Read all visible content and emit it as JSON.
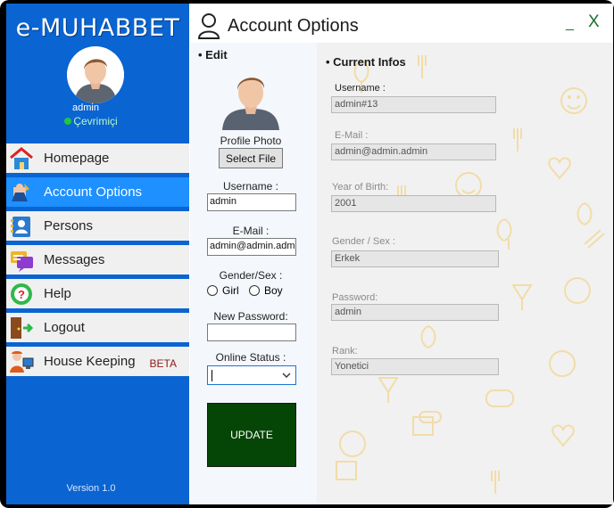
{
  "app": {
    "logo": "e-MUHABBET",
    "user_name": "admin",
    "status": "Çevrimiçi",
    "version": "Version 1.0"
  },
  "nav": [
    {
      "label": "Homepage",
      "icon": "home-icon",
      "active": false
    },
    {
      "label": "Account Options",
      "icon": "account-options-icon",
      "active": true
    },
    {
      "label": "Persons",
      "icon": "persons-icon",
      "active": false
    },
    {
      "label": "Messages",
      "icon": "messages-icon",
      "active": false
    },
    {
      "label": "Help",
      "icon": "help-icon",
      "active": false
    },
    {
      "label": "Logout",
      "icon": "logout-icon",
      "active": false
    },
    {
      "label": "House Keeping",
      "icon": "house-keeping-icon",
      "active": false,
      "badge": "BETA"
    }
  ],
  "header": {
    "title": "Account Options",
    "minimize": "_",
    "close": "X"
  },
  "edit": {
    "heading": "• Edit",
    "profile_photo_label": "Profile Photo",
    "select_file": "Select File",
    "username_label": "Username :",
    "username_value": "admin",
    "email_label": "E-Mail :",
    "email_value": "admin@admin.admin",
    "gender_label": "Gender/Sex :",
    "gender_options": [
      "Girl",
      "Boy"
    ],
    "new_password_label": "New Password:",
    "new_password_value": "",
    "online_status_label": "Online Status :",
    "online_status_value": "",
    "update_button": "UPDATE"
  },
  "info": {
    "heading": "• Current Infos",
    "fields": [
      {
        "label": "Username :",
        "value": "admin#13"
      },
      {
        "label": "E-Mail :",
        "value": "admin@admin.admin"
      },
      {
        "label": "Year of Birth:",
        "value": "2001"
      },
      {
        "label": "Gender / Sex :",
        "value": "Erkek"
      },
      {
        "label": "Password:",
        "value": "admin"
      },
      {
        "label": "Rank:",
        "value": "Yonetici"
      }
    ]
  },
  "colors": {
    "sidebar": "#0a64d2",
    "active_nav": "#1e90ff",
    "update_button": "#054505",
    "status_online": "#20c640",
    "pattern": "#f2dca8"
  }
}
